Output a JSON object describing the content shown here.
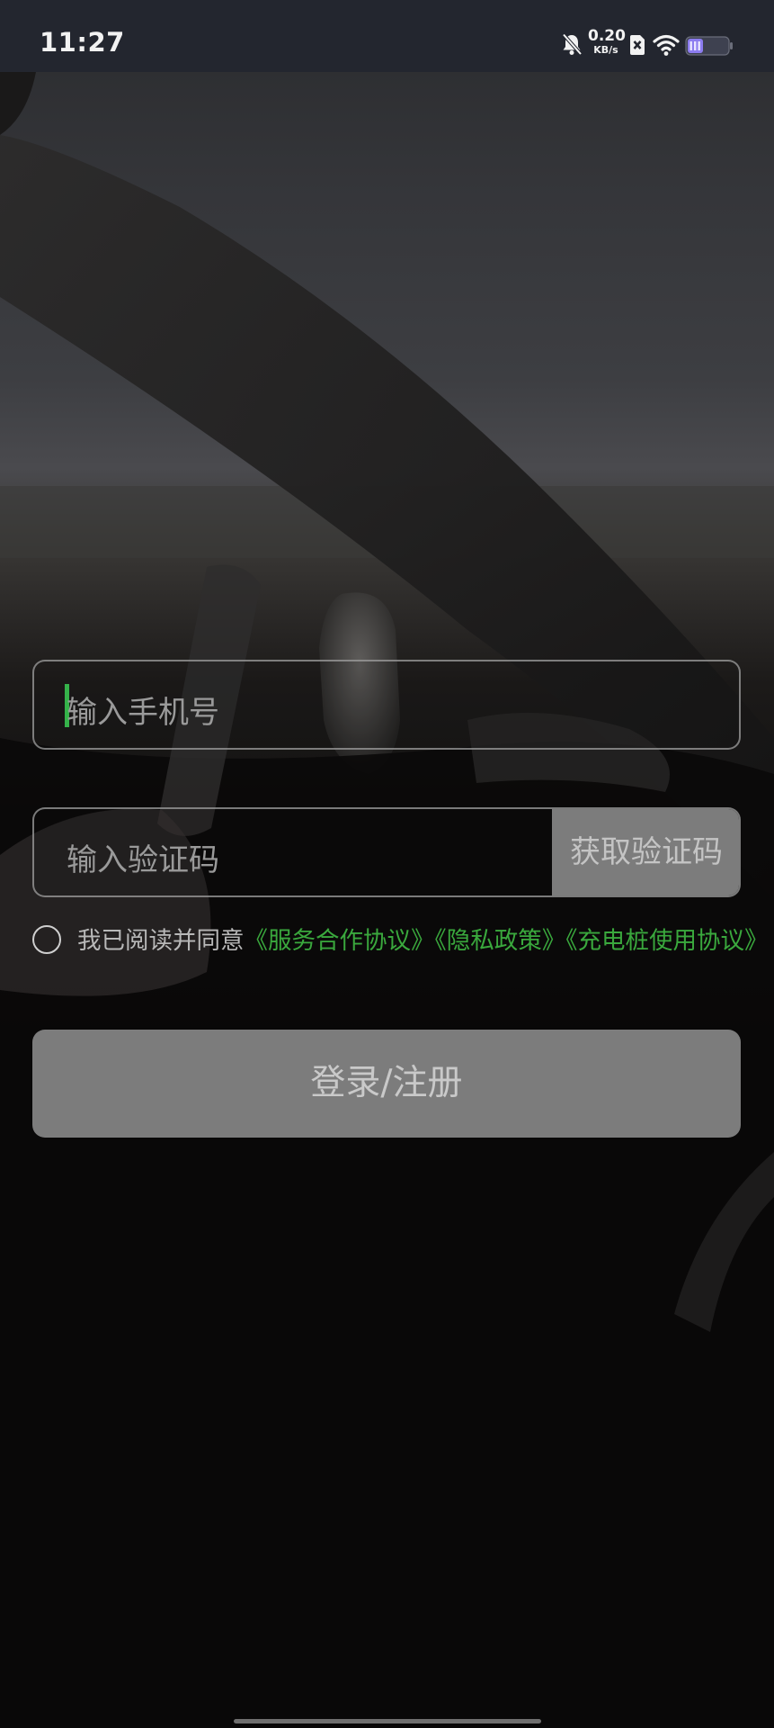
{
  "status_bar": {
    "time": "11:27",
    "net_speed_value": "0.20",
    "net_speed_unit": "KB/s",
    "icons": [
      "bell-muted-icon",
      "sim-blocked-icon",
      "wifi-icon",
      "battery-icon"
    ],
    "battery_color": "#8c7cf0"
  },
  "form": {
    "phone_placeholder": "输入手机号",
    "code_placeholder": "输入验证码",
    "get_code_label": "获取验证码",
    "agreement": {
      "prefix": "我已阅读并同意",
      "service_agreement": "《服务合作协议》",
      "privacy_policy": "《隐私政策》",
      "charger_agreement": "《充电桩使用协议》"
    },
    "login_label": "登录/注册"
  },
  "colors": {
    "accent": "#3aa83d",
    "button_disabled": "#7c7c7c",
    "status_bar_bg": "#23262f"
  }
}
